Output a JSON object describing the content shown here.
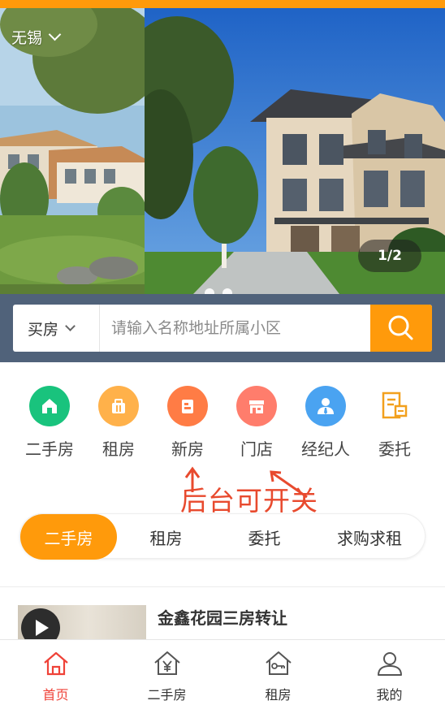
{
  "header": {
    "city": "无锡"
  },
  "banner": {
    "counter": "1/2"
  },
  "search": {
    "type_label": "买房",
    "placeholder": "请输入名称地址所属小区"
  },
  "categories": [
    {
      "label": "二手房",
      "icon": "home-icon",
      "color": "#19c37d"
    },
    {
      "label": "租房",
      "icon": "briefcase-icon",
      "color": "#ffb14a"
    },
    {
      "label": "新房",
      "icon": "building-icon",
      "color": "#ff7c45"
    },
    {
      "label": "门店",
      "icon": "storefront-icon",
      "color": "#ff7d6c"
    },
    {
      "label": "经纪人",
      "icon": "agent-icon",
      "color": "#4aa3f1"
    },
    {
      "label": "委托",
      "icon": "document-icon",
      "color": "#f2a01d"
    }
  ],
  "annotation": "后台可开关",
  "tabs": [
    {
      "label": "二手房",
      "active": true
    },
    {
      "label": "租房",
      "active": false
    },
    {
      "label": "委托",
      "active": false
    },
    {
      "label": "求购求租",
      "active": false
    }
  ],
  "listing": {
    "title": "金鑫花园三房转让"
  },
  "tabbar": [
    {
      "label": "首页",
      "icon": "home-icon",
      "active": true
    },
    {
      "label": "二手房",
      "icon": "house-yen-icon",
      "active": false
    },
    {
      "label": "租房",
      "icon": "house-key-icon",
      "active": false
    },
    {
      "label": "我的",
      "icon": "user-icon",
      "active": false
    }
  ],
  "colors": {
    "accent": "#ff9a0b",
    "search_band": "#50627a",
    "annotation": "#e84a2e",
    "active_tab_text": "#ef4238"
  }
}
